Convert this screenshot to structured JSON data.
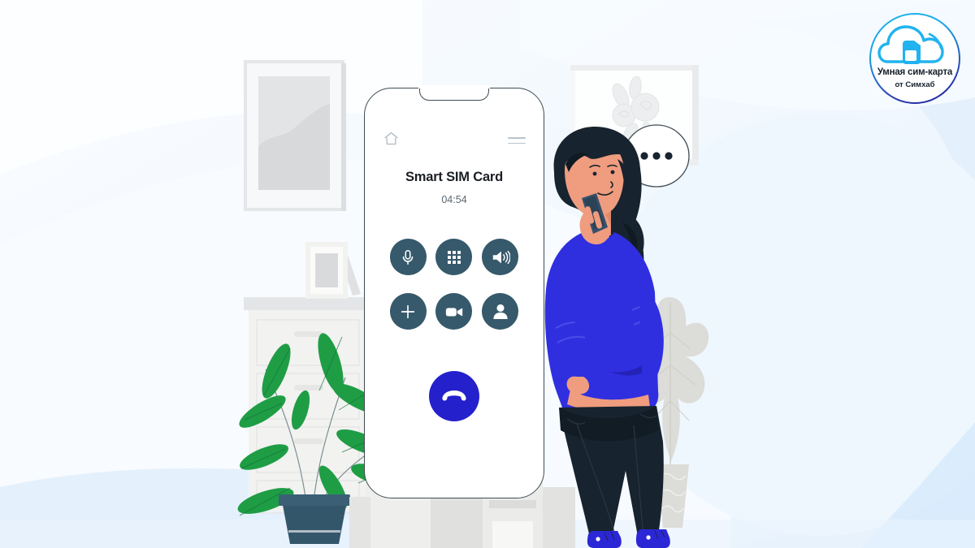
{
  "scene": {
    "background_color": "#f2f8fe",
    "accent_blue": "#2420cc",
    "control_button_color": "#36596b",
    "shirt_color": "#2f2fe0",
    "plant_green": "#1f9d45"
  },
  "phone": {
    "status_icons": {
      "home": "home-icon",
      "menu": "hamburger-menu-icon"
    },
    "call_title": "Smart SIM Card",
    "call_timer": "04:54",
    "controls": [
      {
        "name": "mute-button",
        "icon": "microphone-icon",
        "label": "Mute"
      },
      {
        "name": "keypad-button",
        "icon": "dialpad-icon",
        "label": "Keypad"
      },
      {
        "name": "speaker-button",
        "icon": "speaker-icon",
        "label": "Speaker"
      },
      {
        "name": "add-call-button",
        "icon": "plus-icon",
        "label": "Add call"
      },
      {
        "name": "video-button",
        "icon": "video-camera-icon",
        "label": "Video"
      },
      {
        "name": "contacts-button",
        "icon": "person-icon",
        "label": "Contacts"
      }
    ],
    "end_call": {
      "name": "end-call-button",
      "icon": "phone-hangup-icon",
      "color": "#2420cc"
    }
  },
  "logo": {
    "line1": "Умная сим-карта",
    "line2": "от Симхаб",
    "icon": "cloud-sim-card-icon",
    "cloud_color": "#21b3ef",
    "sim_color": "#21b3ef",
    "ring_gradient_from": "#19b5ec",
    "ring_gradient_to": "#1d1f9e"
  },
  "illustration": {
    "character": {
      "name": "woman-on-phone",
      "hair_color": "#17232e",
      "skin_color": "#ef9c7f",
      "top_color": "#2f2fe0",
      "pants_color": "#17232e",
      "shoes_color": "#2b27d6"
    },
    "speech_bubble": {
      "name": "typing-indicator-bubble",
      "dots": 3
    },
    "wall_frames": [
      {
        "name": "wall-frame-left",
        "content": "abstract-shape"
      },
      {
        "name": "wall-frame-right",
        "content": "roses-illustration"
      }
    ],
    "furniture": [
      {
        "name": "dresser",
        "drawers": 4
      },
      {
        "name": "desk-frame",
        "content": "photo-frame"
      },
      {
        "name": "potted-plant",
        "leaves": 10
      },
      {
        "name": "decorative-leaf-vase"
      }
    ]
  }
}
